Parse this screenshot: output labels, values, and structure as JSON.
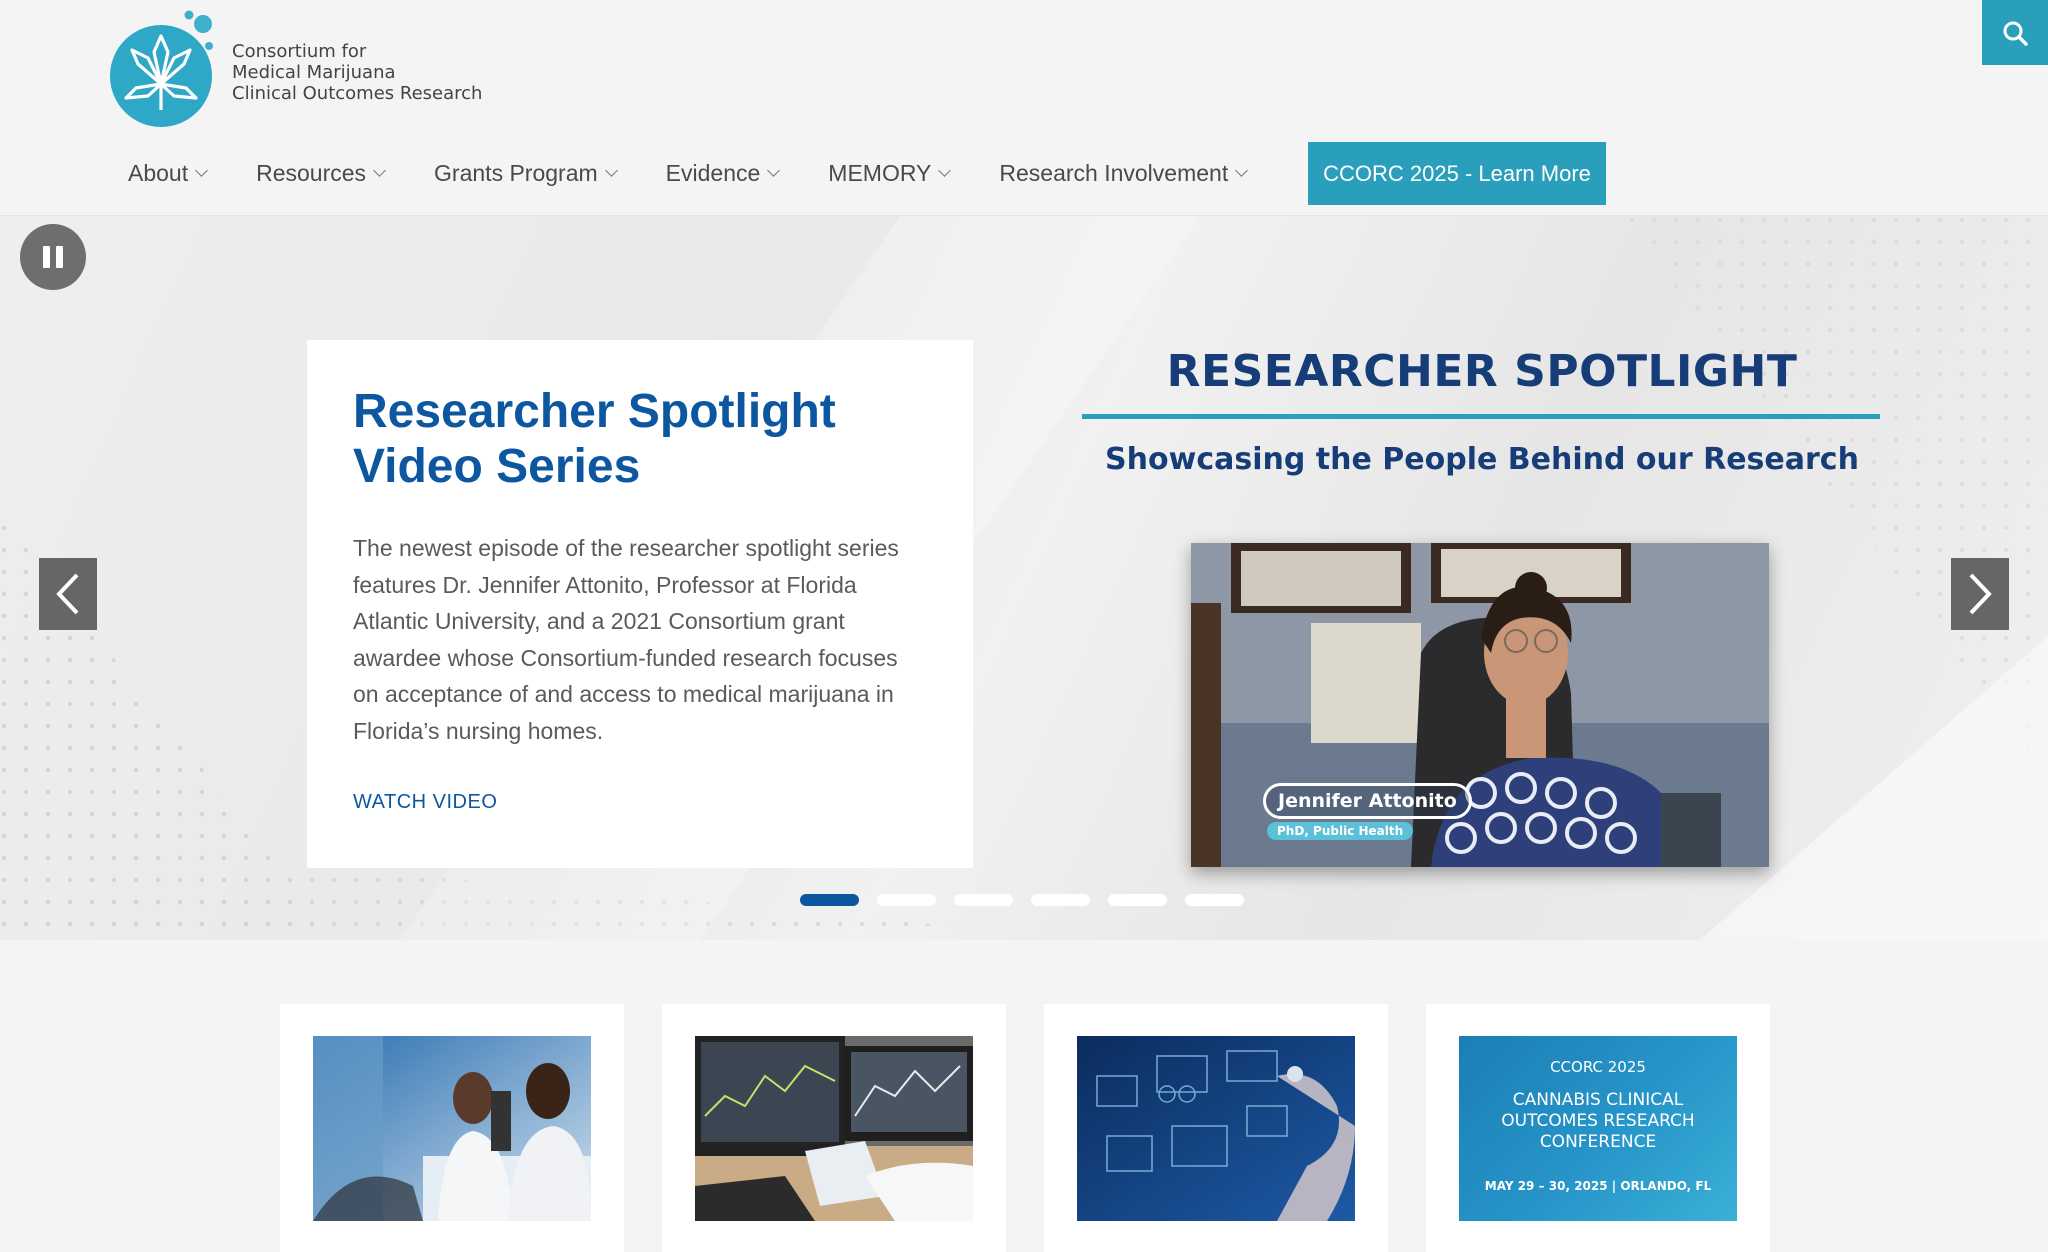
{
  "header": {
    "logo_lines": [
      "Consortium for",
      "Medical Marijuana",
      "Clinical Outcomes Research"
    ],
    "nav": [
      "About",
      "Resources",
      "Grants Program",
      "Evidence",
      "MEMORY",
      "Research Involvement"
    ],
    "cta_label": "CCORC 2025 - Learn More"
  },
  "hero": {
    "card_title": "Researcher Spotlight Video Series",
    "card_text": "The newest episode of the researcher spotlight series features Dr. Jennifer Attonito, Professor at Florida Atlantic University, and a 2021 Consortium grant awardee whose Consortium-funded research focuses on acceptance of and access to medical marijuana in Florida’s nursing homes.",
    "card_link": "WATCH VIDEO",
    "spot_title": "RESEARCHER SPOTLIGHT",
    "spot_subtitle": "Showcasing the People Behind our Research",
    "video_name": "Jennifer Attonito",
    "video_role": "PhD, Public Health",
    "slide_count": 6,
    "active_slide": 1
  },
  "tiles": {
    "conference": {
      "brand": "CCORC 2025",
      "title_lines": [
        "CANNABIS CLINICAL",
        "OUTCOMES RESEARCH",
        "CONFERENCE"
      ],
      "date": "MAY 29 – 30, 2025 | ORLANDO, FL"
    }
  },
  "icons": [
    "logo-icon",
    "search-icon",
    "chevron-down-icon",
    "pause-icon",
    "arrow-left-icon",
    "arrow-right-icon"
  ],
  "colors": {
    "brand_teal": "#2a9fbc",
    "brand_blue": "#0d57a1",
    "navy": "#163d78"
  }
}
